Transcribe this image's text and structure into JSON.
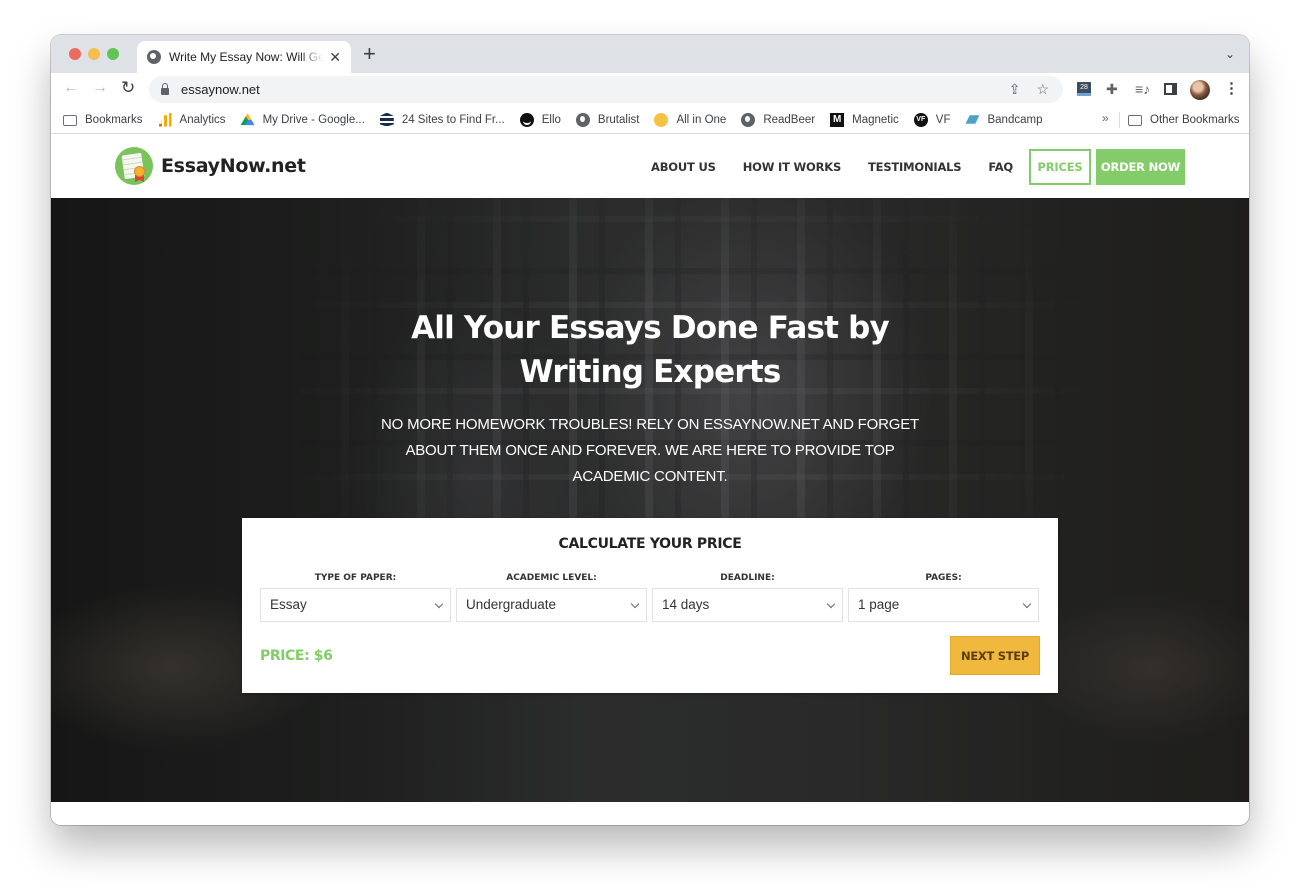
{
  "browser": {
    "tab_title": "Write My Essay Now: Will Get an A+",
    "new_tab_icon": "+",
    "url": "essaynow.net",
    "bookmarks": [
      {
        "label": "Bookmarks",
        "icon": "folder-icon"
      },
      {
        "label": "Analytics",
        "icon": "analytics-icon"
      },
      {
        "label": "My Drive - Google...",
        "icon": "google-drive-icon"
      },
      {
        "label": "24 Sites to Find Fr...",
        "icon": "stack-icon"
      },
      {
        "label": "Ello",
        "icon": "ello-icon"
      },
      {
        "label": "Brutalist",
        "icon": "globe-icon"
      },
      {
        "label": "All in One",
        "icon": "all-in-one-icon"
      },
      {
        "label": "ReadBeer",
        "icon": "globe-icon"
      },
      {
        "label": "Magnetic",
        "icon": "magnetic-icon"
      },
      {
        "label": "VF",
        "icon": "vf-icon"
      },
      {
        "label": "Bandcamp",
        "icon": "bandcamp-icon"
      }
    ],
    "more_bookmarks": "»",
    "other_bookmarks": "Other Bookmarks",
    "calendar_ext_label": "28"
  },
  "site": {
    "logo_text": "EssayNow.net",
    "nav": [
      "ABOUT US",
      "HOW IT WORKS",
      "TESTIMONIALS",
      "FAQ"
    ],
    "prices_button": "PRICES",
    "order_button": "ORDER NOW",
    "accent_color": "#84cc6a",
    "cta_color": "#f0b93e"
  },
  "hero": {
    "title_line1": "All Your Essays Done Fast by",
    "title_line2": "Writing Experts",
    "subtitle": "NO MORE HOMEWORK TROUBLES! RELY ON ESSAYNOW.NET AND FORGET ABOUT THEM ONCE AND FOREVER. WE ARE HERE TO PROVIDE TOP ACADEMIC CONTENT."
  },
  "calculator": {
    "title": "CALCULATE YOUR PRICE",
    "fields": [
      {
        "label": "TYPE OF PAPER:",
        "value": "Essay"
      },
      {
        "label": "ACADEMIC LEVEL:",
        "value": "Undergraduate"
      },
      {
        "label": "DEADLINE:",
        "value": "14 days"
      },
      {
        "label": "PAGES:",
        "value": "1 page"
      }
    ],
    "price_label": "PRICE: $6",
    "next_button": "NEXT STEP"
  }
}
